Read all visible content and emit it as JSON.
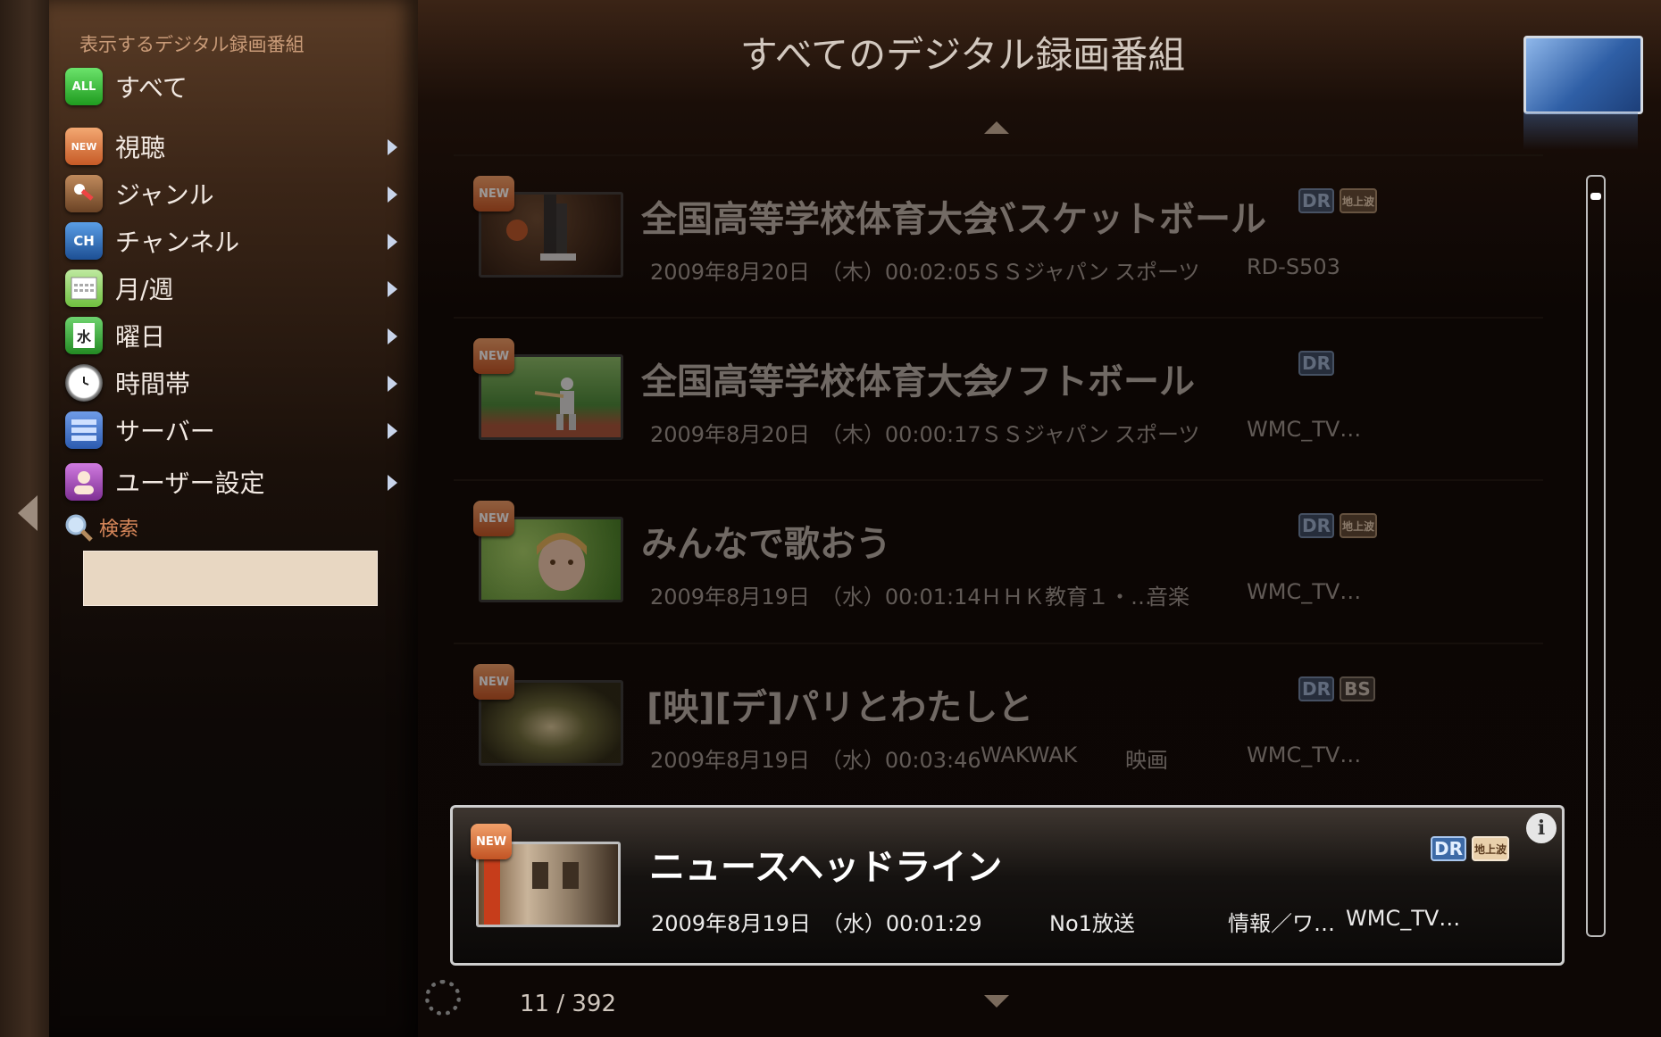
{
  "sidebar": {
    "header": "表示するデジタル録画番組",
    "items": [
      {
        "label": "すべて",
        "icon": "ALL"
      },
      {
        "label": "視聴",
        "icon": "NEW"
      },
      {
        "label": "ジャンル",
        "icon": "genre-icon"
      },
      {
        "label": "チャンネル",
        "icon": "CH"
      },
      {
        "label": "月/週",
        "icon": "calendar-icon"
      },
      {
        "label": "曜日",
        "icon": "水"
      },
      {
        "label": "時間帯",
        "icon": "clock-icon"
      },
      {
        "label": "サーバー",
        "icon": "server-icon"
      },
      {
        "label": "ユーザー設定",
        "icon": "user-icon"
      }
    ],
    "search": {
      "label": "検索",
      "value": ""
    }
  },
  "main": {
    "title": "すべてのデジタル録画番組",
    "pager": "11 / 392",
    "rows": [
      {
        "badge": "NEW",
        "title": "全国高等学校体育大会",
        "subtitle": "バスケットボール",
        "date": "2009年8月20日　（木）00:02:05",
        "channel": "ＳＳジャパン",
        "genre": "スポーツ",
        "device": "RD-S503",
        "tags": [
          "DR",
          "地上波"
        ]
      },
      {
        "badge": "NEW",
        "title": "全国高等学校体育大会",
        "subtitle": "ソフトボール",
        "date": "2009年8月20日　（木）00:00:17",
        "channel": "ＳＳジャパン",
        "genre": "スポーツ",
        "device": "WMC_TV…",
        "tags": [
          "DR"
        ]
      },
      {
        "badge": "NEW",
        "title": "みんなで歌おう",
        "subtitle": "",
        "date": "2009年8月19日　（水）00:01:14",
        "channel": "ＨＨＫ教育１・…",
        "genre": "音楽",
        "device": "WMC_TV…",
        "tags": [
          "DR",
          "地上波"
        ]
      },
      {
        "badge": "NEW",
        "title": "[映][デ]パリとわたしと",
        "subtitle": "",
        "date": "2009年8月19日　（水）00:03:46",
        "channel": "WAKWAK",
        "genre": "映画",
        "device": "WMC_TV…",
        "tags": [
          "DR",
          "BS"
        ]
      },
      {
        "badge": "NEW",
        "title": "ニュースヘッドライン",
        "subtitle": "",
        "date": "2009年8月19日　（水）00:01:29",
        "channel": "No1放送",
        "genre": "情報／ワ…",
        "device": "WMC_TV…",
        "tags": [
          "DR",
          "地上波"
        ]
      }
    ]
  }
}
